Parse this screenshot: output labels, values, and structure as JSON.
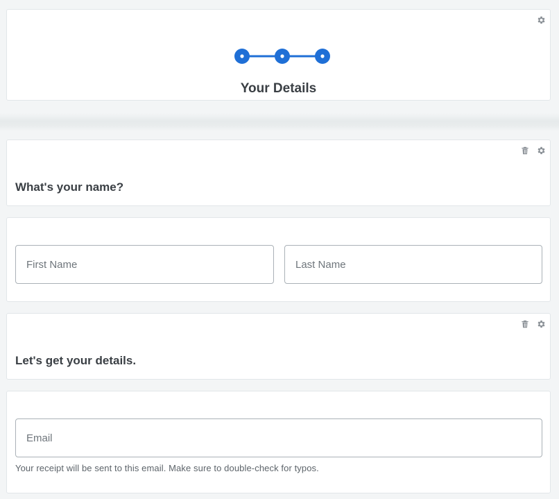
{
  "progress": {
    "step_count": 3,
    "current_step": 3,
    "accent_color": "#1f6fd6"
  },
  "step": {
    "title": "Your Details"
  },
  "name_section": {
    "heading": "What's your name?",
    "first_name": {
      "placeholder": "First Name",
      "value": ""
    },
    "last_name": {
      "placeholder": "Last Name",
      "value": ""
    }
  },
  "details_section": {
    "heading": "Let's get your details.",
    "email": {
      "placeholder": "Email",
      "value": ""
    },
    "email_help": "Your receipt will be sent to this email. Make sure to double-check for typos."
  },
  "icons": {
    "settings": "gear-icon",
    "delete": "trash-icon"
  }
}
